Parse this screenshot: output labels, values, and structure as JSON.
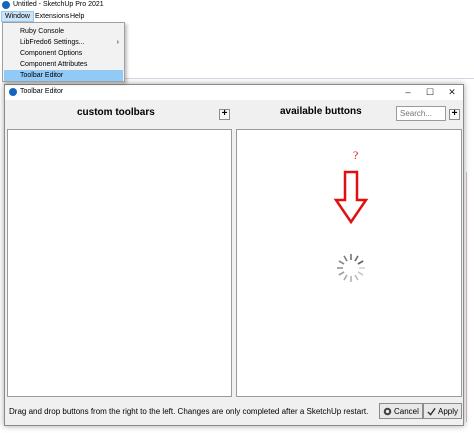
{
  "app": {
    "title": "Untitled - SketchUp Pro 2021",
    "menu": [
      {
        "label": "Window",
        "active": true
      },
      {
        "label": "Extensions",
        "active": false
      },
      {
        "label": "Help",
        "active": false
      }
    ]
  },
  "dropdown": {
    "items": [
      {
        "label": "Ruby Console",
        "submenu": false
      },
      {
        "label": "LibFredo6 Settings...",
        "submenu": true
      },
      {
        "label": "Component Options",
        "submenu": false
      },
      {
        "label": "Component Attributes",
        "submenu": false
      },
      {
        "label": "Toolbar Editor",
        "submenu": false,
        "highlighted": true
      }
    ],
    "submenu_glyph": "›"
  },
  "dialog": {
    "title": "Toolbar Editor",
    "window_controls": {
      "minimize": "–",
      "maximize": "☐",
      "close": "✕"
    },
    "left_heading": "custom toolbars",
    "right_heading": "available buttons",
    "plus_label": "+",
    "search_placeholder": "Search...",
    "annotation_mark": "?",
    "footer_message": "Drag and drop buttons from the right to the left. Changes are only completed after a SketchUp restart.",
    "cancel_label": "Cancel",
    "apply_label": "Apply",
    "colors": {
      "annotation": "#e01010",
      "spinner": "#555555",
      "accent": "#1565c0"
    }
  }
}
